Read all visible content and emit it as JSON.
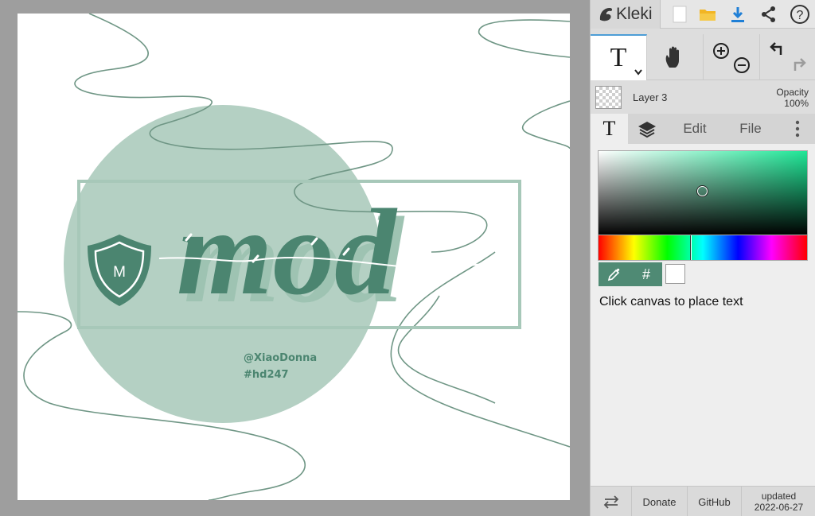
{
  "app": {
    "name": "Kleki"
  },
  "canvas_art": {
    "title_text": "mod",
    "badge_letter": "M",
    "credit_line1": "@XiaoDonna",
    "credit_line2": "#hd247"
  },
  "toolbar": {
    "active_tool_glyph": "T",
    "icons": [
      "new-image-icon",
      "open-folder-icon",
      "download-icon",
      "share-icon",
      "help-icon"
    ]
  },
  "tools": [
    "text-tool-icon",
    "hand-tool-icon",
    "zoom-in-icon",
    "zoom-out-icon",
    "undo-icon",
    "redo-icon"
  ],
  "layer": {
    "name": "Layer 3",
    "opacity_label": "Opacity",
    "opacity_value": "100%"
  },
  "tabs": {
    "text_glyph": "T",
    "edit": "Edit",
    "file": "File"
  },
  "color_picker": {
    "hex_symbol": "#",
    "current_color": "#ffffff",
    "accent": "#4f8a74"
  },
  "hint": "Click canvas to place text",
  "footer": {
    "donate": "Donate",
    "github": "GitHub",
    "updated_label": "updated",
    "updated_date": "2022-06-27"
  }
}
